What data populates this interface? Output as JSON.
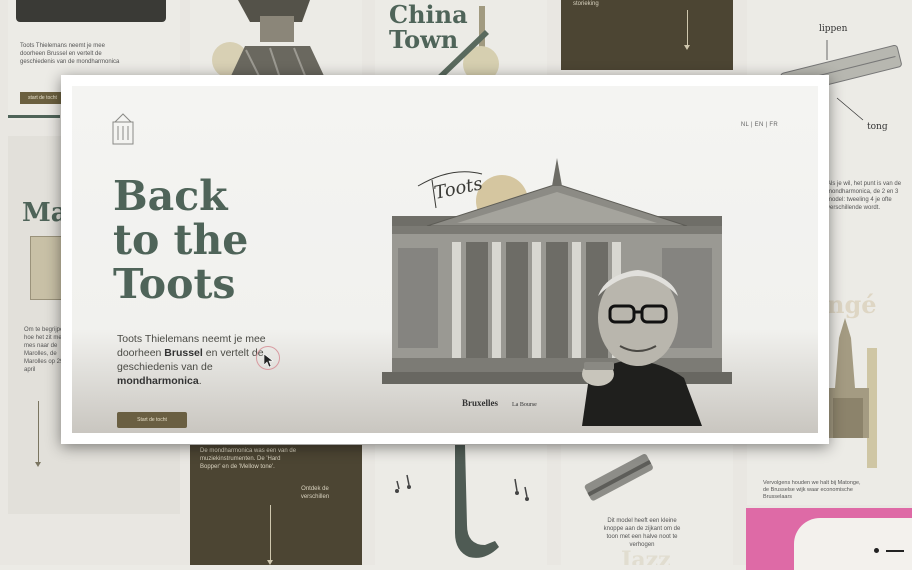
{
  "colors": {
    "accent": "#4f6459",
    "dark_tile": "#4c4533",
    "button": "#6a5f42",
    "pink": "#de6aa6"
  },
  "main": {
    "title_lines": [
      "Back",
      "to the",
      "Toots"
    ],
    "description_parts": {
      "p1": "Toots Thielemans neemt je mee doorheen ",
      "p2": "Brussel",
      "p3": " en vertelt de geschiedenis van de ",
      "p4": "mondharmonica",
      "p5": "."
    },
    "cta_label": "Start de tocht",
    "language_switch": "NL | EN | FR",
    "scene_labels": {
      "bourse": "Bruxelles",
      "bourse_sub": "La Bourse",
      "signature": "Toots"
    }
  },
  "bg": {
    "c1": {
      "t1_text": "Toots Thielemans neemt je mee doorheen Brussel en vertelt de geschiedenis van de mondharmonica",
      "t1_button": "start de tocht",
      "t2_title": "Ma",
      "t2_text": "Om te begrijpen hoe het zit met de mes naar de Marolles, de Marolles op 29 april"
    },
    "c2": {
      "t2_text": "De mondharmonica was een van de muziekinstrumenten. De 'Hard Bopper' en de 'Mellow tone'.",
      "t2_side": "Ontdek de verschillen"
    },
    "c3": {
      "t1_title": "China Town"
    },
    "c4": {
      "t1_text": "storieking",
      "t2_text": "Dit model heeft een kleine knoppe aan de zijkant om de toon met een halve noot te verhogen",
      "t2_title": "Jazz"
    },
    "c5": {
      "t1_label_top": "lippen",
      "t1_label_bottom": "tong",
      "t1_text": "Als je wil, het punt is van de mondharmonica, de 2 en 3 model: tweeling 4 je ofte verschillende wordt.",
      "t2_title": "ngé",
      "t2_text": "Vervolgens houden we halt bij Matonge, de Brusselse wijk waar economische Brusselaars"
    }
  }
}
